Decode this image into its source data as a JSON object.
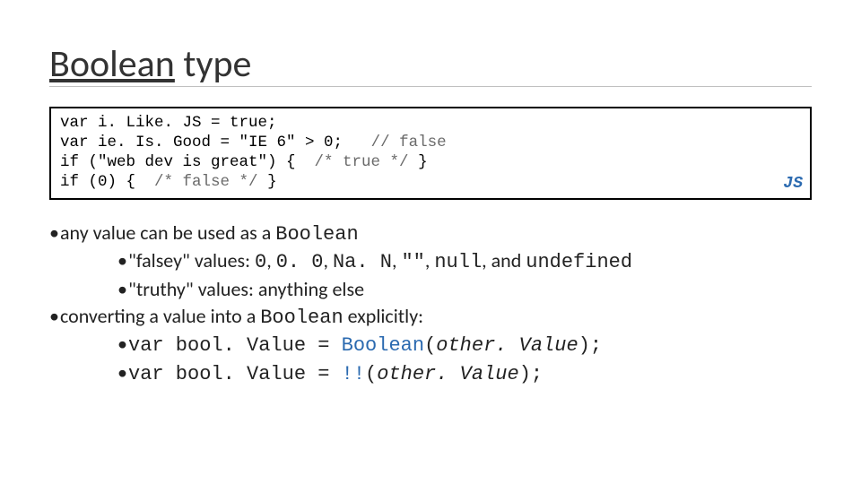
{
  "title": {
    "word1": "Boolean",
    "word2": " type"
  },
  "code": {
    "l1": "var i. Like. JS = true;",
    "l2a": "var ie. Is. Good = \"IE 6\" > 0;   ",
    "l2b": "// false",
    "l3a": "if (\"web dev is great\") {  ",
    "l3b": "/* true */",
    "l3c": " }",
    "l4a": "if (0) {  ",
    "l4b": "/* false */",
    "l4c": " }",
    "label": "JS"
  },
  "bullets": {
    "b1a": "any value can be used as a ",
    "b1b": "Boolean",
    "b2a": "\"falsey\" values: ",
    "b2_vals": "0",
    "b2_sep1": ", ",
    "b2_v2": "0. 0",
    "b2_sep2": ", ",
    "b2_v3": "Na. N",
    "b2_sep3": ", ",
    "b2_v4": "\"\"",
    "b2_sep4": ", ",
    "b2_v5": "null",
    "b2_sep5": ", and ",
    "b2_v6": "undefined",
    "b3": "\"truthy\" values: anything else",
    "b4a": "converting a value into a ",
    "b4b": "Boolean",
    "b4c": " explicitly:",
    "b5a": "var bool. Value = ",
    "b5b": "Boolean",
    "b5c": "(",
    "b5d": "other. Value",
    "b5e": ");",
    "b6a": "var bool. Value = ",
    "b6b": "!!",
    "b6c": "(",
    "b6d": "other. Value",
    "b6e": ");"
  }
}
